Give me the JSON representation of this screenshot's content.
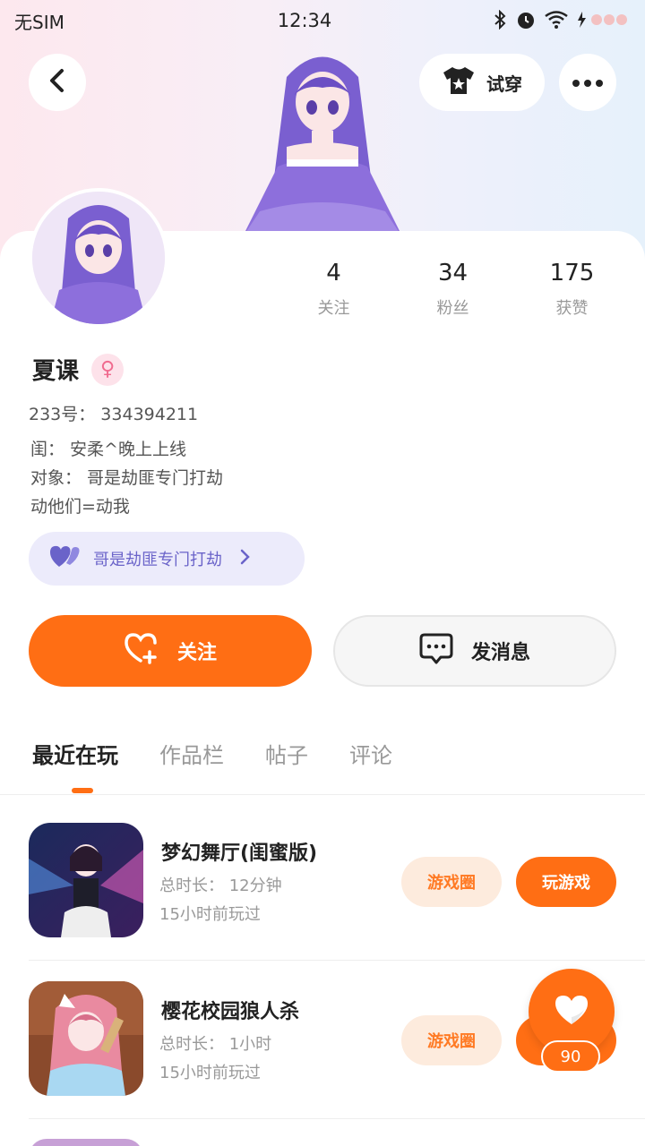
{
  "status_bar": {
    "carrier": "无SIM",
    "time": "12:34"
  },
  "header": {
    "tryon_label": "试穿"
  },
  "profile": {
    "stats": [
      {
        "value": "4",
        "label": "关注"
      },
      {
        "value": "34",
        "label": "粉丝"
      },
      {
        "value": "175",
        "label": "获赞"
      }
    ],
    "name": "夏课",
    "gender_symbol": "♀",
    "uid": "233号： 334394211",
    "bio_lines": [
      "闺： 安柔^晚上上线",
      "对象： 哥是劫匪专门打劫",
      "动他们=动我"
    ],
    "tag_label": "哥是劫匪专门打劫"
  },
  "actions": {
    "follow_label": "关注",
    "message_label": "发消息"
  },
  "tabs": [
    "最近在玩",
    "作品栏",
    "帖子",
    "评论"
  ],
  "games": [
    {
      "title": "梦幻舞厅(闺蜜版)",
      "duration": "总时长： 12分钟",
      "last_played": "15小时前玩过",
      "circle_label": "游戏圈",
      "play_label": "玩游戏"
    },
    {
      "title": "樱花校园狼人杀",
      "duration": "总时长： 1小时",
      "last_played": "15小时前玩过",
      "circle_label": "游戏圈",
      "play_label": "玩游戏"
    }
  ],
  "like_fab": {
    "count": "90"
  },
  "colors": {
    "accent": "#ff6e14",
    "tag_bg": "#ecebfb",
    "tag_text": "#6a63c9",
    "gender_bg": "#fde2ea"
  },
  "icons": {
    "back": "chevron-left-icon",
    "more": "more-icon",
    "tryon": "tshirt-icon",
    "gender": "female-icon",
    "tag": "hearts-icon",
    "follow": "heart-plus-icon",
    "message": "chat-bubble-icon",
    "like": "heart-icon"
  }
}
